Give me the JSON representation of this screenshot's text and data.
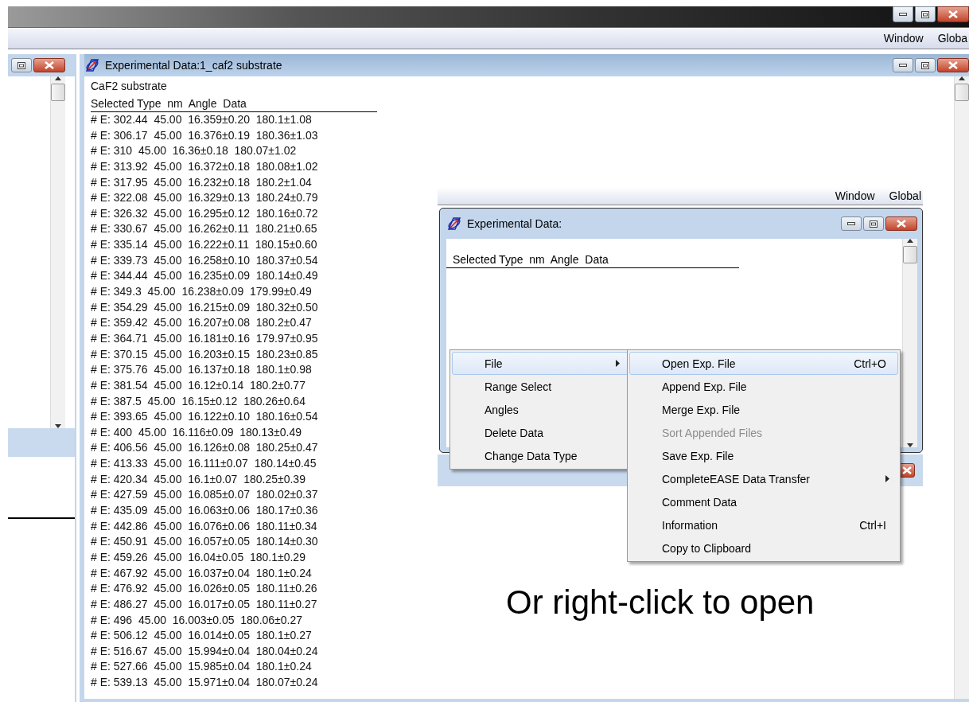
{
  "app_window": {
    "menus": [
      {
        "label": "Window"
      },
      {
        "label": "Globa"
      }
    ]
  },
  "data_window": {
    "title": "Experimental Data:1_caf2 substrate",
    "heading": "CaF2 substrate",
    "columns_header": "Selected Type  nm  Angle  Data",
    "rows": [
      "# E: 302.44  45.00  16.359±0.20  180.1±1.08",
      "# E: 306.17  45.00  16.376±0.19  180.36±1.03",
      "# E: 310  45.00  16.36±0.18  180.07±1.02",
      "# E: 313.92  45.00  16.372±0.18  180.08±1.02",
      "# E: 317.95  45.00  16.232±0.18  180.2±1.04",
      "# E: 322.08  45.00  16.329±0.13  180.24±0.79",
      "# E: 326.32  45.00  16.295±0.12  180.16±0.72",
      "# E: 330.67  45.00  16.262±0.11  180.21±0.65",
      "# E: 335.14  45.00  16.222±0.11  180.15±0.60",
      "# E: 339.73  45.00  16.258±0.10  180.37±0.54",
      "# E: 344.44  45.00  16.235±0.09  180.14±0.49",
      "# E: 349.3  45.00  16.238±0.09  179.99±0.49",
      "# E: 354.29  45.00  16.215±0.09  180.32±0.50",
      "# E: 359.42  45.00  16.207±0.08  180.2±0.47",
      "# E: 364.71  45.00  16.181±0.16  179.97±0.95",
      "# E: 370.15  45.00  16.203±0.15  180.23±0.85",
      "# E: 375.76  45.00  16.137±0.18  180.1±0.98",
      "# E: 381.54  45.00  16.12±0.14  180.2±0.77",
      "# E: 387.5  45.00  16.15±0.12  180.26±0.64",
      "# E: 393.65  45.00  16.122±0.10  180.16±0.54",
      "# E: 400  45.00  16.116±0.09  180.13±0.49",
      "# E: 406.56  45.00  16.126±0.08  180.25±0.47",
      "# E: 413.33  45.00  16.111±0.07  180.14±0.45",
      "# E: 420.34  45.00  16.1±0.07  180.25±0.39",
      "# E: 427.59  45.00  16.085±0.07  180.02±0.37",
      "# E: 435.09  45.00  16.063±0.06  180.17±0.36",
      "# E: 442.86  45.00  16.076±0.06  180.11±0.34",
      "# E: 450.91  45.00  16.057±0.05  180.14±0.30",
      "# E: 459.26  45.00  16.04±0.05  180.1±0.29",
      "# E: 467.92  45.00  16.037±0.04  180.1±0.24",
      "# E: 476.92  45.00  16.026±0.05  180.11±0.26",
      "# E: 486.27  45.00  16.017±0.05  180.11±0.27",
      "# E: 496  45.00  16.003±0.05  180.06±0.27",
      "# E: 506.12  45.00  16.014±0.05  180.1±0.27",
      "# E: 516.67  45.00  15.994±0.04  180.04±0.24",
      "# E: 527.66  45.00  15.985±0.04  180.1±0.24",
      "# E: 539.13  45.00  15.971±0.04  180.07±0.24"
    ]
  },
  "inset": {
    "menus": [
      {
        "label": "Window"
      },
      {
        "label": "Global"
      }
    ],
    "data_window": {
      "title": "Experimental Data:",
      "columns_header": "Selected Type  nm  Angle  Data"
    },
    "context_menu": {
      "items": [
        {
          "label": "File",
          "has_submenu": true,
          "selected": true
        },
        {
          "label": "Range Select",
          "has_submenu": false,
          "selected": false
        },
        {
          "label": "Angles",
          "has_submenu": false,
          "selected": false
        },
        {
          "label": "Delete Data",
          "has_submenu": false,
          "selected": false
        },
        {
          "label": "Change Data Type",
          "has_submenu": false,
          "selected": false
        }
      ]
    },
    "submenu": {
      "items": [
        {
          "label": "Open Exp. File",
          "shortcut": "Ctrl+O",
          "has_submenu": false,
          "selected": true,
          "disabled": false
        },
        {
          "label": "Append Exp. File",
          "has_submenu": false,
          "selected": false,
          "disabled": false
        },
        {
          "label": "Merge Exp. File",
          "has_submenu": false,
          "selected": false,
          "disabled": false
        },
        {
          "label": "Sort Appended Files",
          "has_submenu": false,
          "selected": false,
          "disabled": true
        },
        {
          "label": "Save Exp. File",
          "has_submenu": false,
          "selected": false,
          "disabled": false
        },
        {
          "label": "CompleteEASE Data Transfer",
          "has_submenu": true,
          "selected": false,
          "disabled": false
        },
        {
          "label": "Comment Data",
          "has_submenu": false,
          "selected": false,
          "disabled": false
        },
        {
          "label": "Information",
          "shortcut": "Ctrl+I",
          "has_submenu": false,
          "selected": false,
          "disabled": false
        },
        {
          "label": "Copy to Clipboard",
          "has_submenu": false,
          "selected": false,
          "disabled": false
        }
      ]
    }
  },
  "caption": "Or right-click to open"
}
